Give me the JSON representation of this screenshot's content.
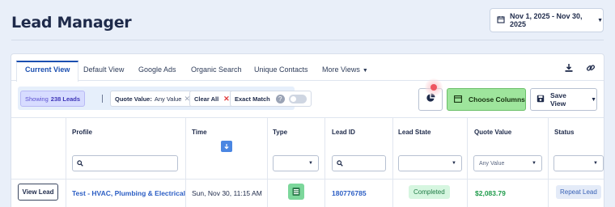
{
  "header": {
    "title": "Lead Manager",
    "date_range": "Nov 1, 2025 - Nov 30, 2025"
  },
  "tabs": [
    {
      "label": "Current View",
      "active": true
    },
    {
      "label": "Default View"
    },
    {
      "label": "Google Ads"
    },
    {
      "label": "Organic Search"
    },
    {
      "label": "Unique Contacts"
    },
    {
      "label": "More Views"
    }
  ],
  "tab_icons": [
    "download-icon",
    "link-icon"
  ],
  "toolbar": {
    "showing_prefix": "Showing",
    "showing_count": "238 Leads",
    "quote_filter_label": "Quote Value:",
    "quote_filter_value": "Any Value",
    "clear_all": "Clear All",
    "exact_match": "Exact Match",
    "exact_match_on": false,
    "choose_columns": "Choose Columns",
    "save_view": "Save View"
  },
  "table": {
    "columns": [
      "Profile",
      "Time",
      "Type",
      "Lead ID",
      "Lead State",
      "Quote Value",
      "Status"
    ],
    "quote_select_value": "Any Value",
    "rows": [
      {
        "action": "View Lead",
        "profile": "Test - HVAC, Plumbing & Electrical",
        "time": "Sun, Nov 30, 11:15 AM",
        "type_icon": "form-icon",
        "lead_id": "180776785",
        "lead_state": "Completed",
        "quote_value": "$2,083.79",
        "status": "Repeat Lead"
      }
    ]
  },
  "colors": {
    "accent": "#1b4fb0",
    "choose_columns_bg": "#9ee59c",
    "completed_bg": "#d6f6e0",
    "quote_green": "#1e9b4a",
    "notification_dot": "#ee5560"
  }
}
